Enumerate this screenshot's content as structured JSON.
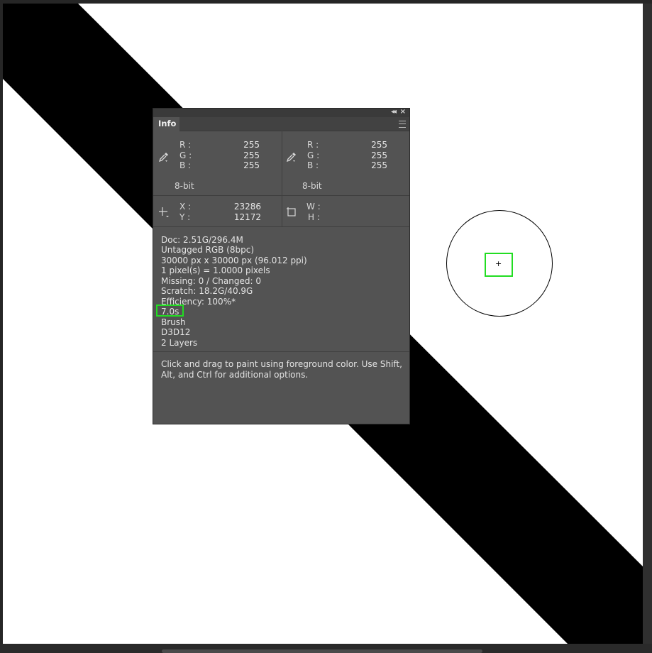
{
  "panel": {
    "tab_label": "Info",
    "color_left": {
      "r_label": "R :",
      "g_label": "G :",
      "b_label": "B :",
      "r": "255",
      "g": "255",
      "b": "255",
      "bit_depth": "8-bit"
    },
    "color_right": {
      "r_label": "R :",
      "g_label": "G :",
      "b_label": "B :",
      "r": "255",
      "g": "255",
      "b": "255",
      "bit_depth": "8-bit"
    },
    "coords": {
      "x_label": "X :",
      "y_label": "Y :",
      "x": "23286",
      "y": "12172"
    },
    "size": {
      "w_label": "W :",
      "h_label": "H :"
    },
    "doc_info": {
      "doc": "Doc: 2.51G/296.4M",
      "profile": "Untagged RGB (8bpc)",
      "dimensions": "30000 px x 30000 px (96.012 ppi)",
      "pixel_ratio": "1 pixel(s) = 1.0000 pixels",
      "missing_changed": "Missing: 0 / Changed: 0",
      "scratch": "Scratch: 18.2G/40.9G",
      "efficiency": "Efficiency: 100%*",
      "timing": "7.0s",
      "tool": "Brush",
      "renderer": "D3D12",
      "layers": "2 Layers"
    },
    "help_text": "Click and drag to paint using foreground color.  Use Shift, Alt, and Ctrl for additional options."
  },
  "icons": {
    "collapse": "double-left-chevron-icon",
    "close": "close-icon",
    "menu": "hamburger-icon",
    "eyedropper": "eyedropper-icon",
    "crosshair": "crosshair-icon",
    "selection": "selection-icon"
  },
  "colors": {
    "canvas_bg": "#ffffff",
    "stroke": "#000000",
    "panel_bg": "#535353",
    "highlight": "#22dd22"
  }
}
